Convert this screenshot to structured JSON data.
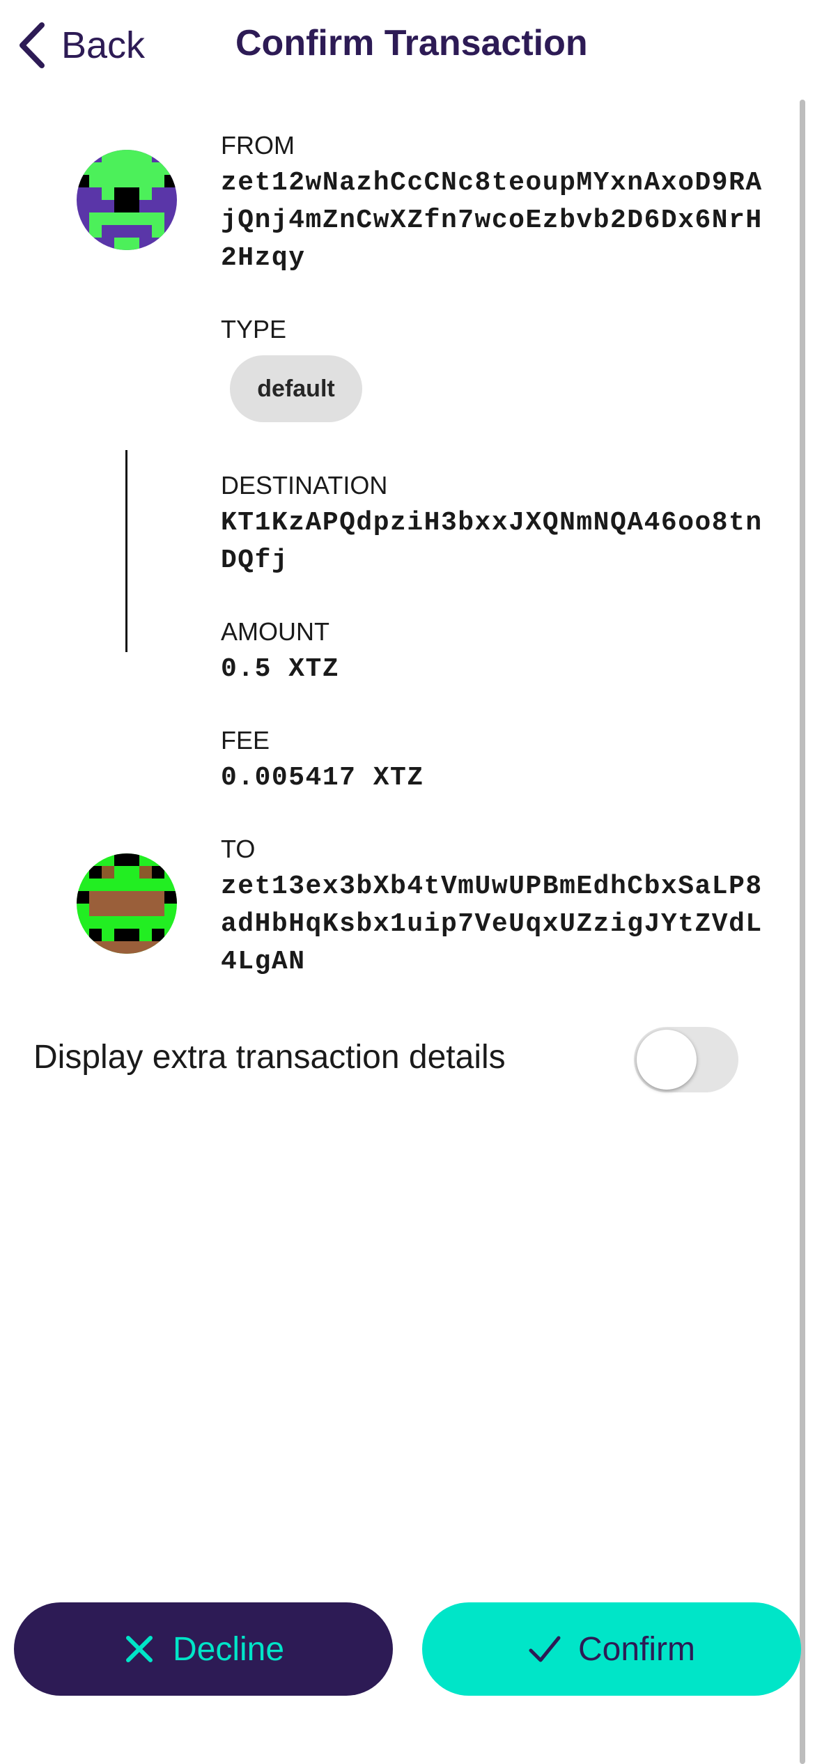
{
  "header": {
    "back_label": "Back",
    "title": "Confirm Transaction"
  },
  "transaction": {
    "from_label": "FROM",
    "from_address": "zet12wNazhCcCNc8teoupMYxnAxoD9RAjQnj4mZnCwXZfn7wcoEzbvb2D6Dx6NrH2Hzqy",
    "type_label": "TYPE",
    "type_value": "default",
    "destination_label": "DESTINATION",
    "destination_address": "KT1KzAPQdpziH3bxxJXQNmNQA46oo8tnDQfj",
    "amount_label": "AMOUNT",
    "amount_value": "0.5 XTZ",
    "fee_label": "FEE",
    "fee_value": "0.005417 XTZ",
    "to_label": "TO",
    "to_address": "zet13ex3bXb4tVmUwUPBmEdhCbxSaLP8adHbHqKsbx1uip7VeUqxUZzigJYtZVdL4LgAN"
  },
  "extra_details": {
    "label": "Display extra transaction details",
    "enabled": false
  },
  "actions": {
    "decline_label": "Decline",
    "confirm_label": "Confirm"
  },
  "colors": {
    "primary": "#2d1b55",
    "accent": "#00e5c8",
    "chip_bg": "#e0e0e0"
  },
  "icons": {
    "back": "chevron-left-icon",
    "decline": "close-icon",
    "confirm": "checkmark-icon"
  }
}
